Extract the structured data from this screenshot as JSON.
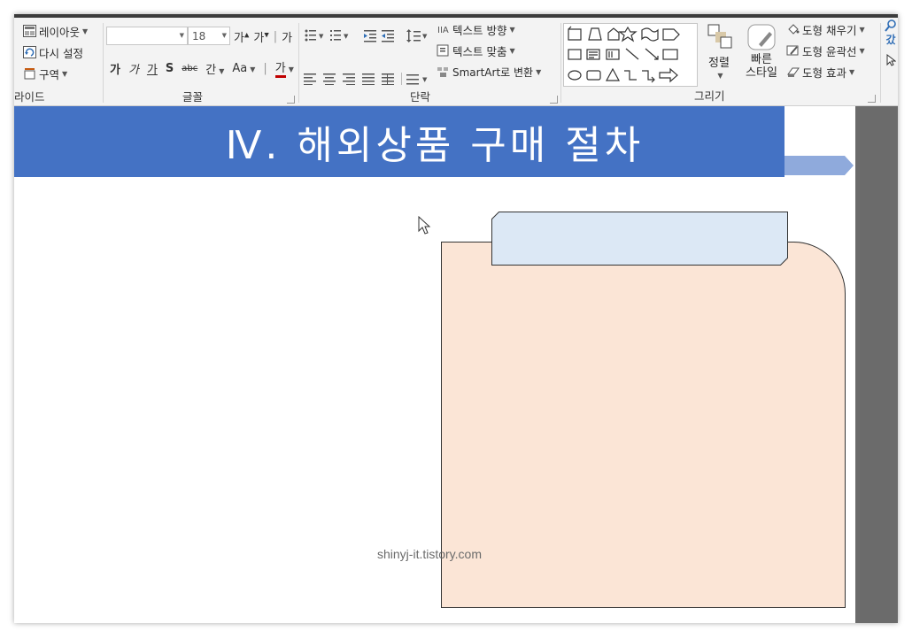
{
  "ribbon": {
    "slide_group": {
      "layout_label": "레이아웃",
      "reset_label": "다시 설정",
      "section_label": "구역",
      "group_label": "라이드"
    },
    "font_group": {
      "font_name": "",
      "font_size": "18",
      "grow_label": "가",
      "shrink_label": "가",
      "clear_label": "가",
      "bold_label": "가",
      "italic_label": "가",
      "underline_label": "가",
      "shadow_label": "S",
      "strike_label": "abc",
      "spacing_label": "간",
      "case_label": "Aa",
      "color_label": "가",
      "group_label": "글꼴"
    },
    "paragraph_group": {
      "text_direction_label": "텍스트 방향",
      "align_text_label": "텍스트 맞춤",
      "smartart_label": "SmartArt로 변환",
      "group_label": "단락"
    },
    "drawing_group": {
      "arrange_label": "정렬",
      "quick_styles_label": "빠른 스타일",
      "quick_styles_line1": "빠른",
      "quick_styles_line2": "스타일",
      "fill_label": "도형 채우기",
      "outline_label": "도형 윤곽선",
      "effects_label": "도형 효과",
      "group_label": "그리기"
    },
    "find_label": "갔"
  },
  "slide": {
    "title": "Ⅳ. 해외상품 구매 절차",
    "watermark": "shinyj-it.tistory.com"
  },
  "colors": {
    "title_blue": "#4472c4",
    "arrow_light_blue": "#8faadc",
    "card_fill": "#fbe5d6",
    "tab_fill": "#dce8f5"
  }
}
